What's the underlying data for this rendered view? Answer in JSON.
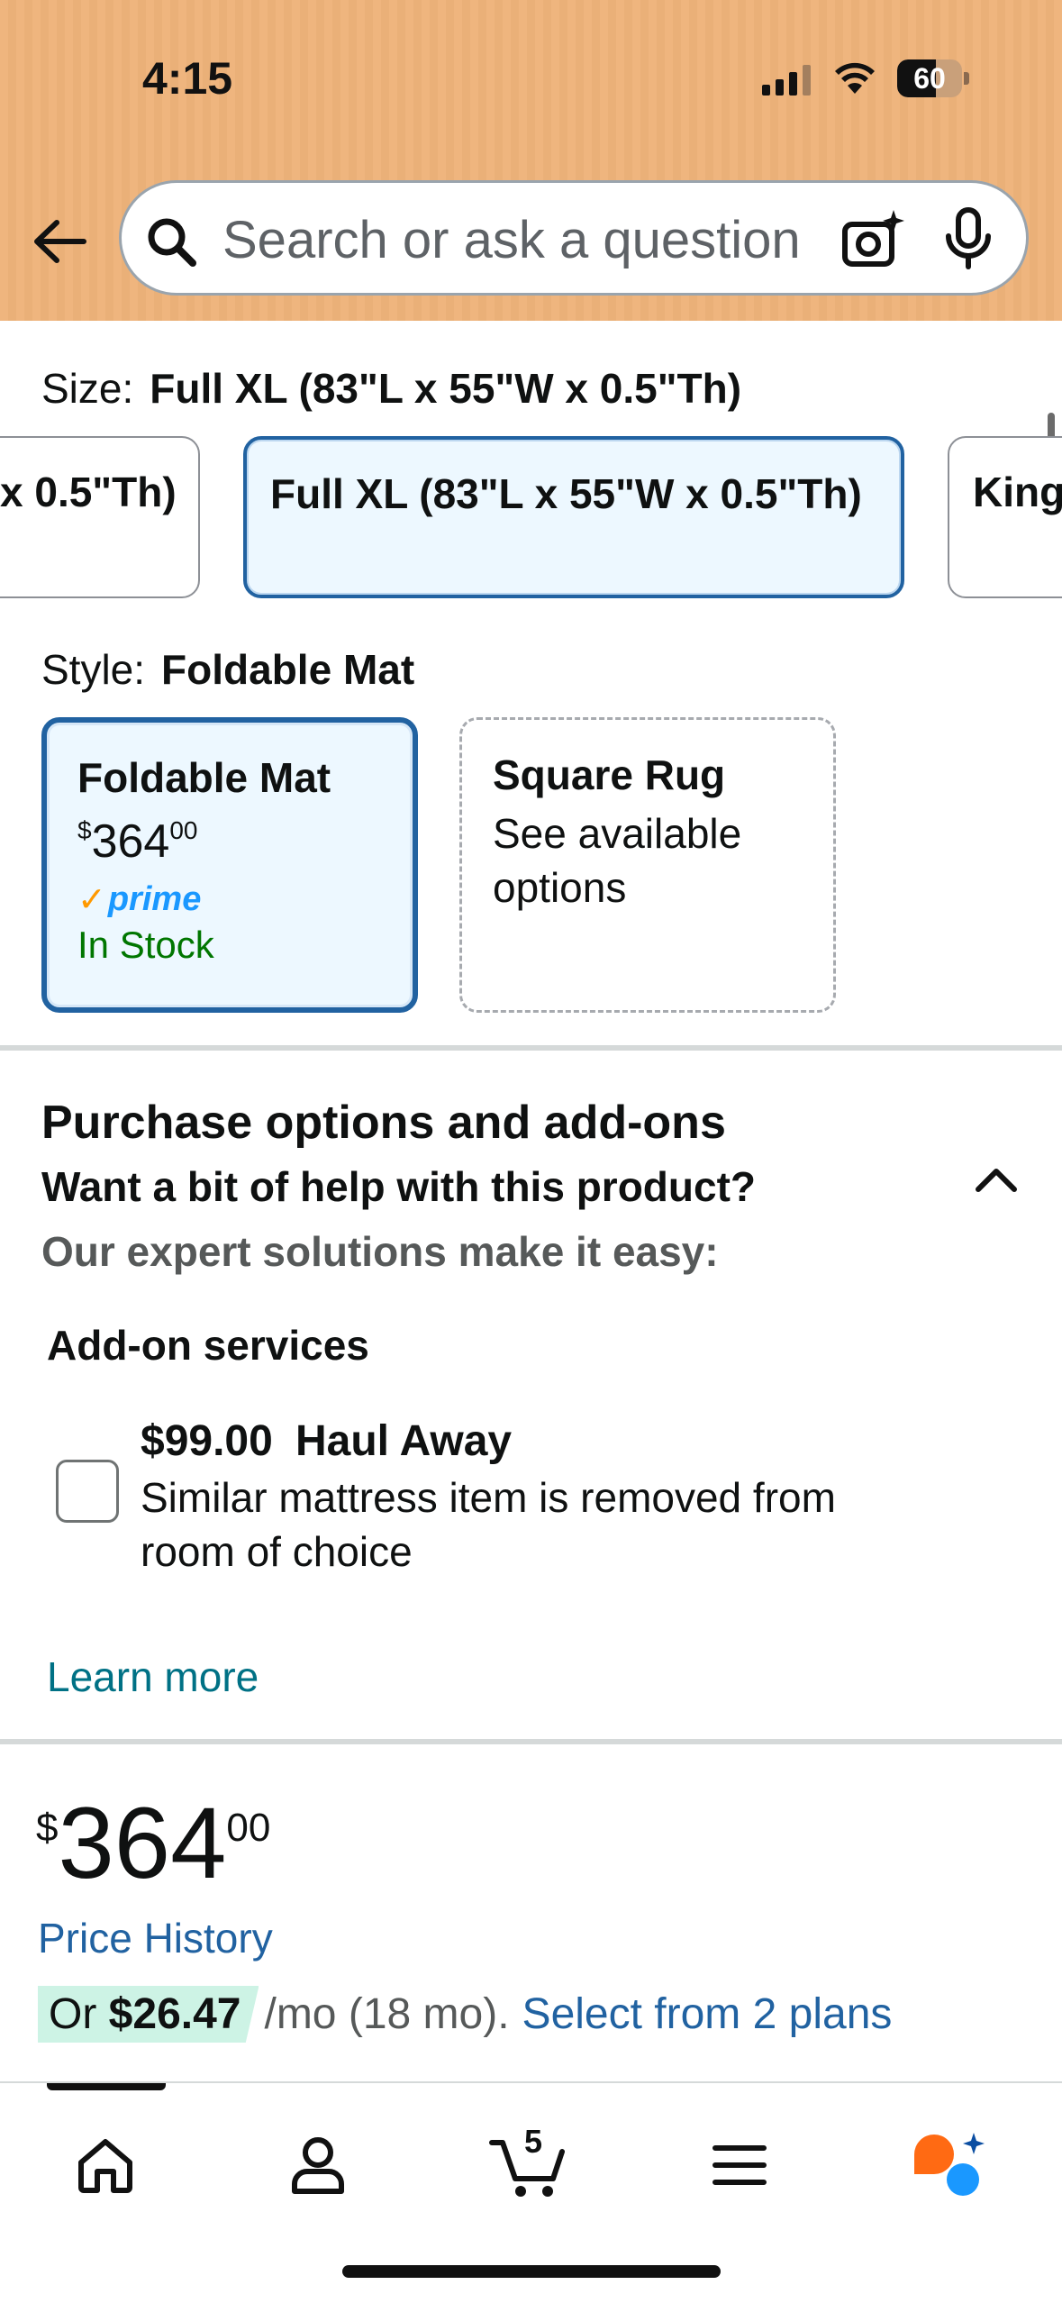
{
  "status_bar": {
    "time": "4:15",
    "battery": "60",
    "battery_level": 0.6
  },
  "search": {
    "placeholder": "Search or ask a question"
  },
  "size": {
    "label": "Size:",
    "selected": "Full XL (83\"L x 55\"W x 0.5\"Th)",
    "options": [
      {
        "label": "x 0.5\"Th)",
        "selected": false
      },
      {
        "label": "Full XL (83\"L x 55\"W x 0.5\"Th)",
        "selected": true
      },
      {
        "label": "King",
        "selected": false
      }
    ]
  },
  "style": {
    "label": "Style:",
    "selected": "Foldable Mat",
    "options": [
      {
        "title": "Foldable Mat",
        "price_symbol": "$",
        "price_whole": "364",
        "price_fraction": "00",
        "prime": "prime",
        "stock": "In Stock",
        "selected": true
      },
      {
        "title": "Square Rug",
        "subtitle": "See available options",
        "selected": false
      }
    ]
  },
  "purchase_options": {
    "title": "Purchase options and add-ons",
    "help_question": "Want a bit of help with this product?",
    "help_subtitle": "Our expert solutions make it easy:",
    "addon_heading": "Add-on services",
    "addon": {
      "price": "$99.00",
      "name": "Haul Away",
      "description": "Similar mattress item is removed from room of choice",
      "checked": false
    },
    "learn_more": "Learn more"
  },
  "price": {
    "symbol": "$",
    "whole": "364",
    "fraction": "00",
    "history_link": "Price History",
    "financing_prefix": "Or",
    "financing_amount": "$26.47",
    "financing_terms": "/mo (18 mo).",
    "financing_link": "Select from 2 plans"
  },
  "bottom_nav": {
    "cart_count": "5",
    "items": [
      "home-icon",
      "account-icon",
      "cart-icon",
      "menu-icon",
      "rufus-icon"
    ]
  },
  "colors": {
    "header_bg": "#efb57e",
    "selected_border": "#2162a1",
    "selected_bg": "#edf8ff",
    "link": "#2162a1",
    "teal_link": "#007185",
    "in_stock": "#007600",
    "prime_blue": "#1a98ff",
    "financing_highlight": "#cdf3e5"
  }
}
